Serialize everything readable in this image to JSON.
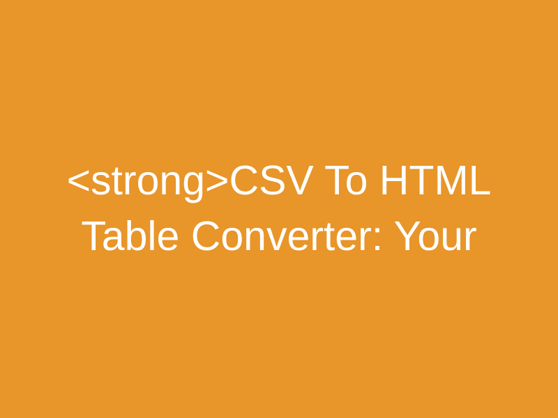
{
  "title": {
    "text": "<strong>CSV To HTML Table Converter: Your"
  },
  "colors": {
    "background": "#e89529",
    "text": "#ffffff"
  }
}
